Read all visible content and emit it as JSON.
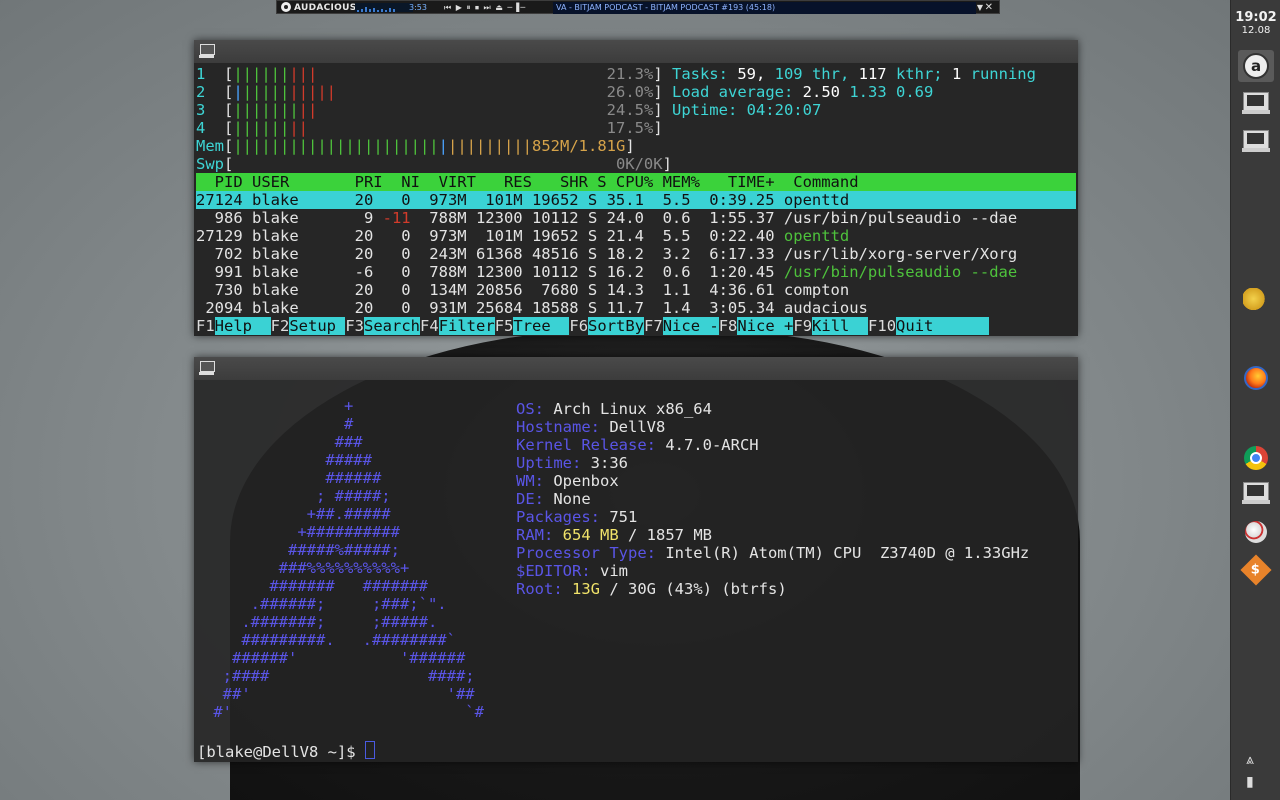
{
  "audacious_bar": {
    "app_name": "AUDACIOUS",
    "time": "3:53",
    "controls": "⏮ ▶ ⏸ ⏹ ⏭ ⏏ ─▐─",
    "track_title": "VA - BITJAM PODCAST - BITJAM PODCAST #193 (45:18)"
  },
  "htop": {
    "cpus": [
      {
        "num": "1",
        "bars_green": "||||||",
        "bars_red": "|||",
        "bars_blue": "",
        "pct": "21.3%"
      },
      {
        "num": "2",
        "bars_green": "|||||",
        "bars_red": "|||||",
        "bars_blue": "|",
        "pct": "26.0%"
      },
      {
        "num": "3",
        "bars_green": "|||||||",
        "bars_red": "||",
        "bars_blue": "",
        "pct": "24.5%"
      },
      {
        "num": "4",
        "bars_green": "||||||",
        "bars_red": "||",
        "bars_blue": "",
        "pct": "17.5%"
      }
    ],
    "mem_label": "Mem",
    "mem_bars_green": "||||||||||||||||||||||",
    "mem_bars_blue": "|",
    "mem_bars_orange": "|||||||||",
    "mem_value": "852M/1.81G",
    "swp_label": "Swp",
    "swp_value": "0K/0K",
    "tasks_label": "Tasks:",
    "tasks_value": "59,",
    "thr_value": "109",
    "thr_label": "thr,",
    "kthr_value": "117",
    "kthr_label": "kthr;",
    "running_value": "1",
    "running_label": "running",
    "load_label": "Load average:",
    "load1": "2.50",
    "load5": "1.33",
    "load15": "0.69",
    "uptime_label": "Uptime:",
    "uptime_value": "04:20:07",
    "header": "  PID USER       PRI  NI  VIRT   RES   SHR S CPU% MEM%   TIME+  Command",
    "processes": [
      {
        "pid": "27124",
        "user": "blake",
        "pri": "20",
        "ni": "0",
        "virt": "973M",
        "res": "101M",
        "shr": "19652",
        "s": "S",
        "cpu": "35.1",
        "mem": "5.5",
        "time": "0:39.25",
        "cmd": "openttd"
      },
      {
        "pid": "986",
        "user": "blake",
        "pri": "9",
        "ni": "-11",
        "virt": "788M",
        "res": "12300",
        "shr": "10112",
        "s": "S",
        "cpu": "24.0",
        "mem": "0.6",
        "time": "1:55.37",
        "cmd": "/usr/bin/pulseaudio --dae"
      },
      {
        "pid": "27129",
        "user": "blake",
        "pri": "20",
        "ni": "0",
        "virt": "973M",
        "res": "101M",
        "shr": "19652",
        "s": "S",
        "cpu": "21.4",
        "mem": "5.5",
        "time": "0:22.40",
        "cmd": "openttd"
      },
      {
        "pid": "702",
        "user": "blake",
        "pri": "20",
        "ni": "0",
        "virt": "243M",
        "res": "61368",
        "shr": "48516",
        "s": "S",
        "cpu": "18.2",
        "mem": "3.2",
        "time": "6:17.33",
        "cmd": "/usr/lib/xorg-server/Xorg"
      },
      {
        "pid": "991",
        "user": "blake",
        "pri": "-6",
        "ni": "0",
        "virt": "788M",
        "res": "12300",
        "shr": "10112",
        "s": "S",
        "cpu": "16.2",
        "mem": "0.6",
        "time": "1:20.45",
        "cmd": "/usr/bin/pulseaudio --dae"
      },
      {
        "pid": "730",
        "user": "blake",
        "pri": "20",
        "ni": "0",
        "virt": "134M",
        "res": "20856",
        "shr": "7680",
        "s": "S",
        "cpu": "14.3",
        "mem": "1.1",
        "time": "4:36.61",
        "cmd": "compton"
      },
      {
        "pid": "2094",
        "user": "blake",
        "pri": "20",
        "ni": "0",
        "virt": "931M",
        "res": "25684",
        "shr": "18588",
        "s": "S",
        "cpu": "11.7",
        "mem": "1.4",
        "time": "3:05.34",
        "cmd": "audacious"
      }
    ],
    "fkeys": [
      {
        "key": "F1",
        "label": "Help  "
      },
      {
        "key": "F2",
        "label": "Setup "
      },
      {
        "key": "F3",
        "label": "Search"
      },
      {
        "key": "F4",
        "label": "Filter"
      },
      {
        "key": "F5",
        "label": "Tree  "
      },
      {
        "key": "F6",
        "label": "SortBy"
      },
      {
        "key": "F7",
        "label": "Nice -"
      },
      {
        "key": "F8",
        "label": "Nice +"
      },
      {
        "key": "F9",
        "label": "Kill  "
      },
      {
        "key": "F10",
        "label": "Quit      "
      }
    ]
  },
  "neofetch": {
    "logo_lines": [
      "               +",
      "               #",
      "              ###",
      "             #####",
      "             ######",
      "            ; #####;",
      "           +##.#####",
      "          +##########",
      "         #####%#####;",
      "        ###%%%%%%%%%%+",
      "       #######   #######",
      "     .######;     ;###;`\".",
      "    .#######;     ;#####.",
      "    #########.   .########`",
      "   ######'           '######",
      "  ;####                 ####;",
      "  ##'                     '##",
      " #'                         `#"
    ],
    "info": [
      {
        "key": "OS:",
        "value": "Arch Linux x86_64"
      },
      {
        "key": "Hostname:",
        "value": "DellV8"
      },
      {
        "key": "Kernel Release:",
        "value": "4.7.0-ARCH"
      },
      {
        "key": "Uptime:",
        "value": "3:36"
      },
      {
        "key": "WM:",
        "value": "Openbox"
      },
      {
        "key": "DE:",
        "value": "None"
      },
      {
        "key": "Packages:",
        "value": "751"
      }
    ],
    "ram_key": "RAM:",
    "ram_used": "654 MB",
    "ram_rest": "/ 1857 MB",
    "cpu_key": "Processor Type:",
    "cpu_value": "Intel(R) Atom(TM) CPU  Z3740D @ 1.33GHz",
    "editor_key": "$EDITOR:",
    "editor_value": "vim",
    "root_key": "Root:",
    "root_used": "13G",
    "root_rest": "/ 30G (43%) (btrfs)",
    "prompt": "[blake@DellV8 ~]$ "
  },
  "dock": {
    "time": "19:02",
    "date": "12.08",
    "money_symbol": "$"
  }
}
